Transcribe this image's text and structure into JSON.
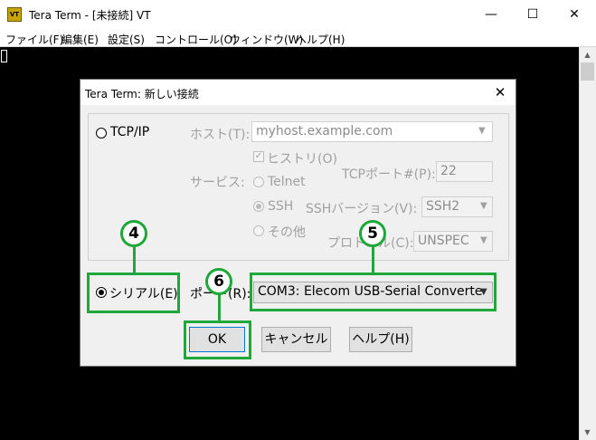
{
  "window": {
    "icon_text": "VT",
    "title": "Tera Term - [未接続] VT",
    "controls": {
      "minimize": "—",
      "maximize": "☐",
      "close": "✕"
    }
  },
  "menu": [
    "ファイル(F)",
    "編集(E)",
    "設定(S)",
    "コントロール(O)",
    "ウィンドウ(W)",
    "ヘルプ(H)"
  ],
  "dialog": {
    "title": "Tera Term: 新しい接続",
    "close": "✕",
    "tcpip": {
      "label": "TCP/IP",
      "host_label": "ホスト(T):",
      "host_value": "myhost.example.com",
      "history_label": "ヒストリ(O)",
      "service_label": "サービス:",
      "telnet_label": "Telnet",
      "ssh_label": "SSH",
      "other_label": "その他",
      "tcp_port_label": "TCPポート#(P):",
      "tcp_port_value": "22",
      "ssh_version_label": "SSHバージョン(V):",
      "ssh_version_value": "SSH2",
      "protocol_label": "プロトコル(C):",
      "protocol_value": "UNSPEC"
    },
    "serial": {
      "label": "シリアル(E)",
      "port_label": "ポート(R):",
      "port_value": "COM3: Elecom USB-Serial Converte"
    },
    "buttons": {
      "ok": "OK",
      "cancel": "キャンセル",
      "help": "ヘルプ(H)"
    }
  },
  "annotations": {
    "step4": "4",
    "step5": "5",
    "step6": "6"
  },
  "colors": {
    "highlight": "#1ea83a",
    "terminal_bg": "#000000"
  }
}
